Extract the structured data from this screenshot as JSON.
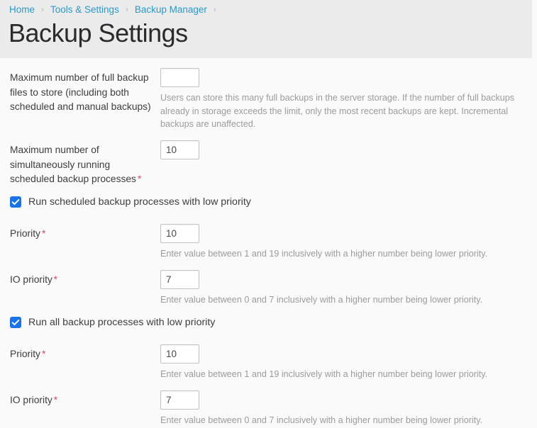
{
  "header": {
    "breadcrumb": [
      {
        "label": "Home",
        "sep": "›"
      },
      {
        "label": "Tools & Settings",
        "sep": "›"
      },
      {
        "label": "Backup Manager",
        "sep": "›"
      }
    ],
    "title": "Backup Settings"
  },
  "colors": {
    "accent_link": "#2a9ac8",
    "checkbox_checked": "#1a73e8",
    "required_mark": "#d9486f",
    "header_band": "#ebebeb",
    "page_background": "#fafafa"
  },
  "form": {
    "max_full_backups": {
      "label": "Maximum number of full backup files to store (including both scheduled and manual backups)",
      "value": "",
      "placeholder": "",
      "hint": "Users can store this many full backups in the server storage. If the number of full backups already in storage exceeds the limit, only the most recent backups are kept. Incremental backups are unaffected."
    },
    "max_simultaneous_processes": {
      "label": "Maximum number of simultaneously running scheduled backup processes",
      "required_mark": "*",
      "value": "10",
      "placeholder": ""
    },
    "scheduled_low_priority": {
      "checkbox_label": "Run scheduled backup processes with low priority",
      "checked": true,
      "priority": {
        "label": "Priority",
        "required_mark": "*",
        "value": "10",
        "hint": "Enter value between 1 and 19 inclusively with a higher number being lower priority."
      },
      "io_priority": {
        "label": "IO priority",
        "required_mark": "*",
        "value": "7",
        "hint": "Enter value between 0 and 7 inclusively with a higher number being lower priority."
      }
    },
    "all_low_priority": {
      "checkbox_label": "Run all backup processes with low priority",
      "checked": true,
      "priority": {
        "label": "Priority",
        "required_mark": "*",
        "value": "10",
        "hint": "Enter value between 1 and 19 inclusively with a higher number being lower priority."
      },
      "io_priority": {
        "label": "IO priority",
        "required_mark": "*",
        "value": "7",
        "hint": "Enter value between 0 and 7 inclusively with a higher number being lower priority."
      }
    }
  }
}
